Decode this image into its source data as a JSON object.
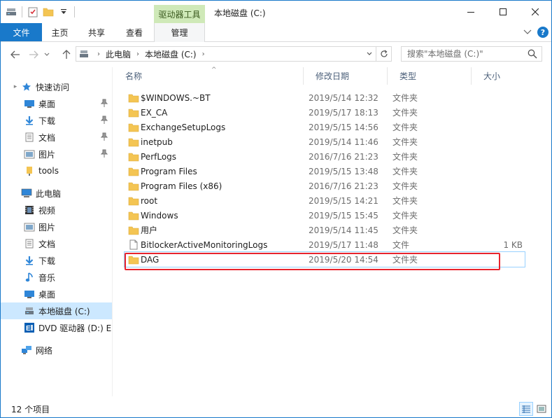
{
  "colors": {
    "accent": "#1979ca",
    "context_tab": "#cfe9b8",
    "selection": "#cce8ff",
    "highlight_box": "#e8242d",
    "folder": "#f4c553"
  },
  "titlebar": {
    "context_group": "驱动器工具",
    "title": "本地磁盘 (C:)",
    "minimize_icon": "minimize-icon",
    "maximize_icon": "maximize-icon",
    "close_icon": "close-icon"
  },
  "ribbon": {
    "tabs": {
      "file": "文件",
      "home": "主页",
      "share": "共享",
      "view": "查看",
      "manage": "管理"
    },
    "expand_icon": "chevron-down-icon",
    "help_label": "?"
  },
  "address": {
    "crumbs": [
      "此电脑",
      "本地磁盘 (C:)"
    ],
    "search_placeholder": "搜索\"本地磁盘 (C:)\""
  },
  "sidebar": {
    "quick_access": "快速访问",
    "quick_items": [
      "桌面",
      "下载",
      "文档",
      "图片",
      "tools"
    ],
    "this_pc": "此电脑",
    "pc_items": [
      "视频",
      "图片",
      "文档",
      "下载",
      "音乐",
      "桌面",
      "本地磁盘 (C:)",
      "DVD 驱动器 (D:) E"
    ],
    "network": "网络"
  },
  "columns": {
    "name": "名称",
    "date": "修改日期",
    "type": "类型",
    "size": "大小"
  },
  "files": [
    {
      "name": "$WINDOWS.~BT",
      "date": "2019/5/14 12:32",
      "type": "文件夹",
      "size": "",
      "kind": "folder"
    },
    {
      "name": "EX_CA",
      "date": "2019/5/17 18:13",
      "type": "文件夹",
      "size": "",
      "kind": "folder"
    },
    {
      "name": "ExchangeSetupLogs",
      "date": "2019/5/15 14:56",
      "type": "文件夹",
      "size": "",
      "kind": "folder"
    },
    {
      "name": "inetpub",
      "date": "2019/5/14 11:46",
      "type": "文件夹",
      "size": "",
      "kind": "folder"
    },
    {
      "name": "PerfLogs",
      "date": "2016/7/16 21:23",
      "type": "文件夹",
      "size": "",
      "kind": "folder"
    },
    {
      "name": "Program Files",
      "date": "2019/5/15 13:48",
      "type": "文件夹",
      "size": "",
      "kind": "folder"
    },
    {
      "name": "Program Files (x86)",
      "date": "2016/7/16 21:23",
      "type": "文件夹",
      "size": "",
      "kind": "folder"
    },
    {
      "name": "root",
      "date": "2019/5/15 14:21",
      "type": "文件夹",
      "size": "",
      "kind": "folder"
    },
    {
      "name": "Windows",
      "date": "2019/5/15 15:45",
      "type": "文件夹",
      "size": "",
      "kind": "folder"
    },
    {
      "name": "用户",
      "date": "2019/5/14 11:45",
      "type": "文件夹",
      "size": "",
      "kind": "folder"
    },
    {
      "name": "BitlockerActiveMonitoringLogs",
      "date": "2019/5/17 11:48",
      "type": "文件",
      "size": "1 KB",
      "kind": "file"
    },
    {
      "name": "DAG",
      "date": "2019/5/20 14:54",
      "type": "文件夹",
      "size": "",
      "kind": "folder"
    }
  ],
  "status": {
    "item_count": "12 个项目"
  }
}
